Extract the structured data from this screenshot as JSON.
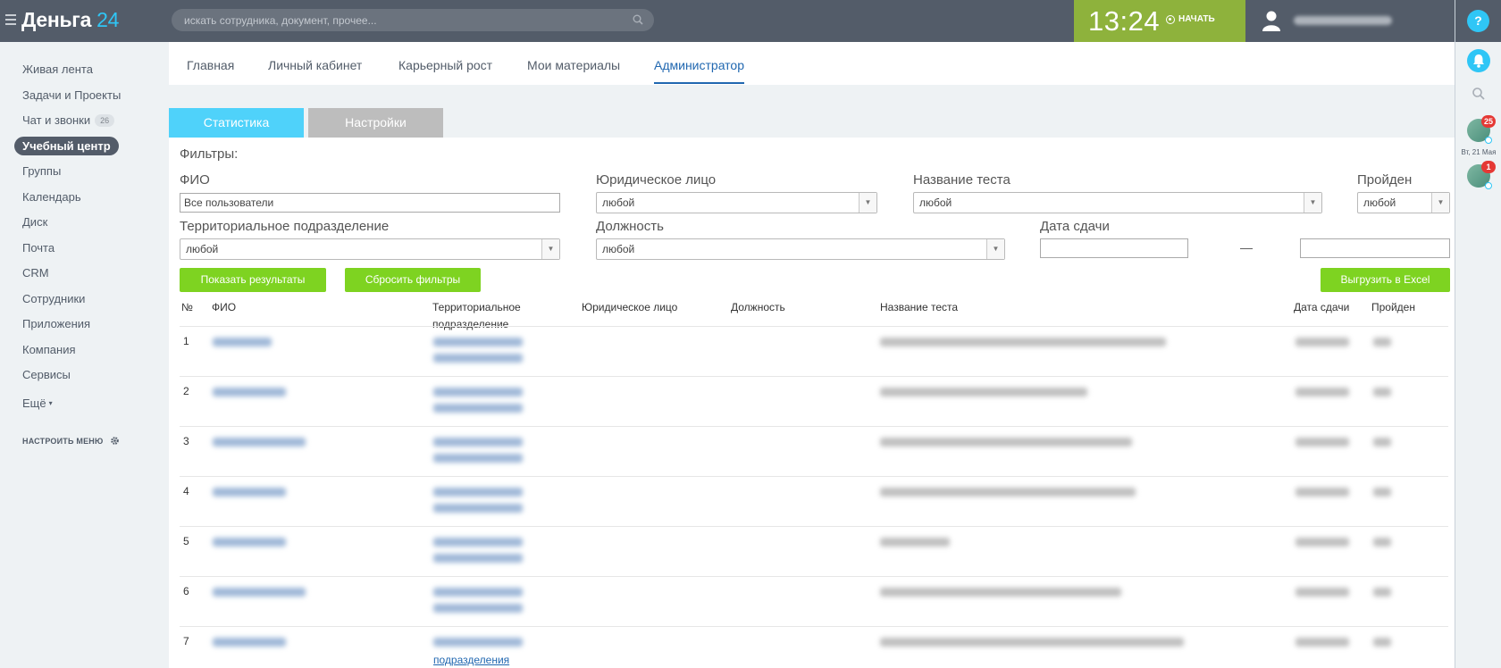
{
  "header": {
    "logo_text": "Деньга",
    "logo_num": "24",
    "search_placeholder": "искать сотрудника, документ, прочее...",
    "clock_time": "13:24",
    "start_label": "НАЧАТЬ"
  },
  "right_rail": {
    "help_label": "?",
    "badge_1": "25",
    "date_label": "Вт, 21 Мая",
    "badge_2": "1"
  },
  "sidebar": {
    "items": [
      {
        "label": "Живая лента"
      },
      {
        "label": "Задачи и Проекты"
      },
      {
        "label": "Чат и звонки",
        "count": "26"
      },
      {
        "label": "Учебный центр"
      },
      {
        "label": "Группы"
      },
      {
        "label": "Календарь"
      },
      {
        "label": "Диск"
      },
      {
        "label": "Почта"
      },
      {
        "label": "CRM"
      },
      {
        "label": "Сотрудники"
      },
      {
        "label": "Приложения"
      },
      {
        "label": "Компания"
      },
      {
        "label": "Сервисы"
      },
      {
        "label": "Ещё"
      }
    ],
    "configure_label": "НАСТРОИТЬ МЕНЮ"
  },
  "top_tabs": [
    "Главная",
    "Личный кабинет",
    "Карьерный рост",
    "Мои материалы",
    "Администратор"
  ],
  "section_tabs": {
    "statistics": "Статистика",
    "settings": "Настройки"
  },
  "filters": {
    "title": "Фильтры:",
    "fio_label": "ФИО",
    "fio_value": "Все пользователи",
    "legal_label": "Юридическое лицо",
    "legal_value": "любой",
    "test_label": "Название теста",
    "test_value": "любой",
    "passed_label": "Пройден",
    "passed_value": "любой",
    "territory_label": "Территориальное подразделение",
    "territory_value": "любой",
    "position_label": "Должность",
    "position_value": "любой",
    "date_label": "Дата сдачи",
    "date_from": "",
    "date_to": "",
    "dash": "—",
    "show_btn": "Показать результаты",
    "reset_btn": "Сбросить фильтры",
    "export_btn": "Выгрузить в Excel"
  },
  "table": {
    "columns": {
      "num": "№",
      "fio": "ФИО",
      "territory_1": "Территориальное",
      "territory_2": "подразделение",
      "legal": "Юридическое лицо",
      "position": "Должность",
      "test": "Название теста",
      "date": "Дата сдачи",
      "passed": "Пройден"
    },
    "rows": [
      {
        "num": "1"
      },
      {
        "num": "2"
      },
      {
        "num": "3"
      },
      {
        "num": "4"
      },
      {
        "num": "5"
      },
      {
        "num": "6"
      },
      {
        "num": "7",
        "territory_visible": "подразделения"
      }
    ]
  }
}
